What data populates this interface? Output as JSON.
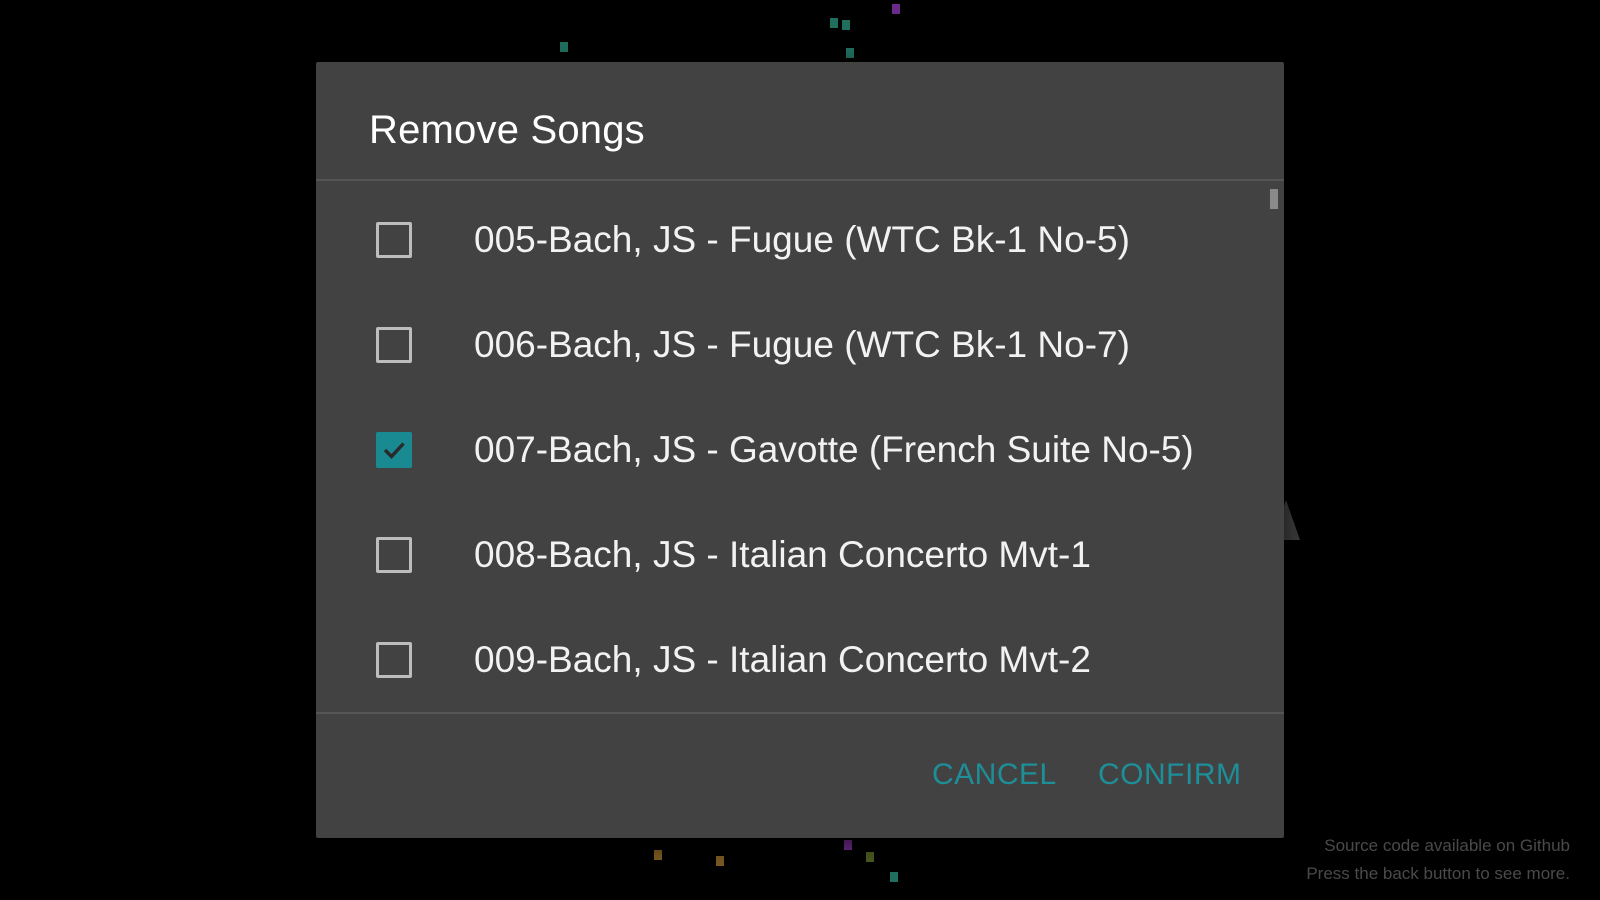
{
  "dialog": {
    "title": "Remove Songs",
    "songs": [
      {
        "label": "005-Bach, JS - Fugue (WTC Bk-1 No-5)",
        "checked": false
      },
      {
        "label": "006-Bach, JS - Fugue (WTC Bk-1 No-7)",
        "checked": false
      },
      {
        "label": "007-Bach, JS - Gavotte (French Suite No-5)",
        "checked": true
      },
      {
        "label": "008-Bach, JS - Italian Concerto Mvt-1",
        "checked": false
      },
      {
        "label": "009-Bach, JS - Italian Concerto Mvt-2",
        "checked": false
      }
    ],
    "cancel_label": "CANCEL",
    "confirm_label": "CONFIRM"
  },
  "footer": {
    "line1": "Source code available on Github",
    "line2": "Press the back button to see more."
  },
  "colors": {
    "accent": "#1a8a92",
    "dialog_bg": "#424242",
    "background": "#000000"
  },
  "icons": {
    "checkbox_checked": "check-icon"
  }
}
